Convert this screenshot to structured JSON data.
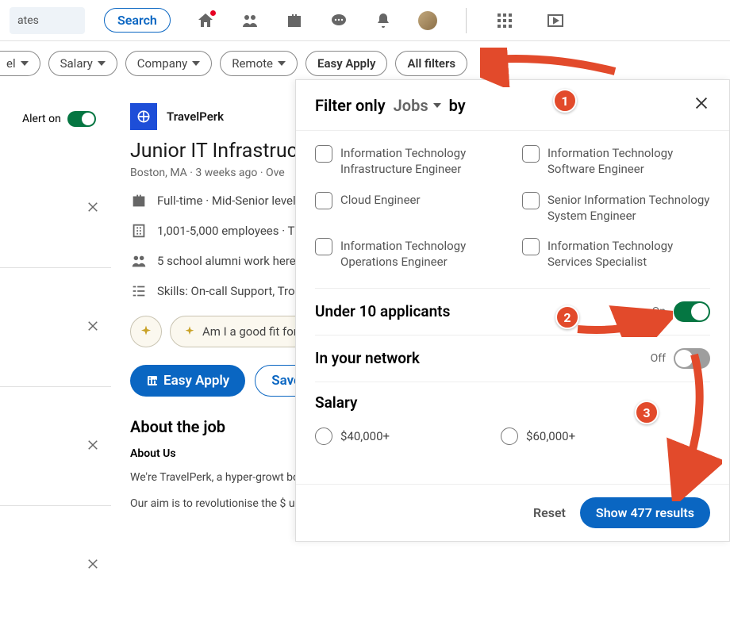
{
  "topbar": {
    "search_partial": "ates",
    "search_tab": "Search"
  },
  "filter_pills": {
    "p0": "el",
    "p1": "Salary",
    "p2": "Company",
    "p3": "Remote",
    "p4": "Easy Apply",
    "p5": "All filters"
  },
  "left": {
    "alert_label": "Alert on"
  },
  "job": {
    "company": "TravelPerk",
    "title": "Junior IT Infrastruc",
    "meta": "Boston, MA · 3 weeks ago · Ove",
    "line1": "Full-time · Mid-Senior level",
    "line2": "1,001-5,000 employees · T",
    "line3": "5 school alumni work here",
    "line4": "Skills: On-call Support, Tro",
    "fit_prompt": "Am I a good fit for",
    "easy_apply": "Easy Apply",
    "save": "Save",
    "about_h": "About the job",
    "about_sub": "About Us",
    "about_p1": "We're TravelPerk, a hyper-growt booking, managing and reportin",
    "about_p2": "Our aim is to revolutionise the $ unrivalled choice of travel optio"
  },
  "overlay": {
    "filter_only": "Filter only",
    "jobs_dd": "Jobs",
    "by": "by",
    "titles": {
      "t0": "Information Technology Infrastructure Engineer",
      "t1": "Information Technology Software Engineer",
      "t2": "Cloud Engineer",
      "t3": "Senior Information Technology System Engineer",
      "t4": "Information Technology Operations Engineer",
      "t5": "Information Technology Services Specialist"
    },
    "under10": "Under 10 applicants",
    "under10_state": "On",
    "network": "In your network",
    "network_state": "Off",
    "salary_h": "Salary",
    "salary_opts": {
      "s0": "$40,000+",
      "s1": "$60,000+"
    },
    "reset": "Reset",
    "show_results": "Show 477 results"
  },
  "annotations": {
    "b1": "1",
    "b2": "2",
    "b3": "3"
  }
}
